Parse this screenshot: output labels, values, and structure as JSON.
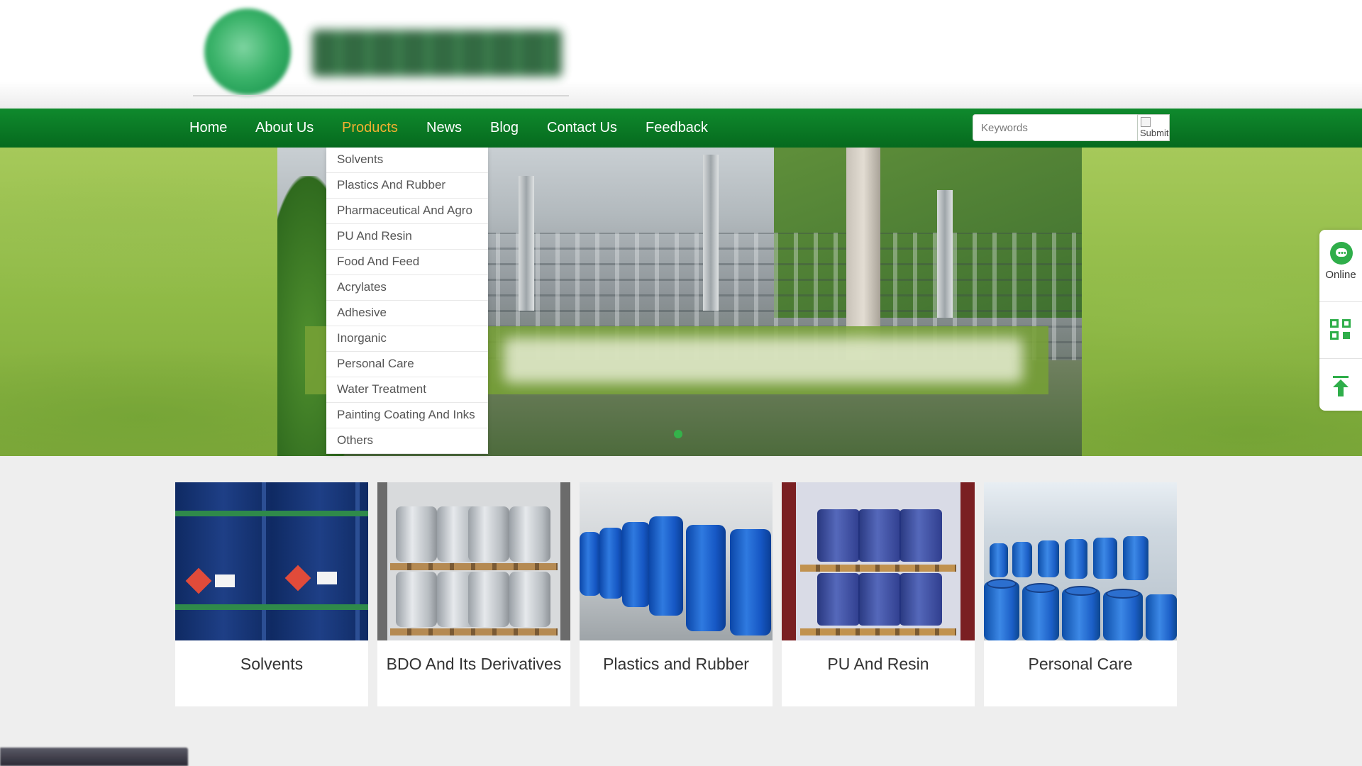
{
  "nav": {
    "items": [
      {
        "label": "Home",
        "active": false
      },
      {
        "label": "About Us",
        "active": false
      },
      {
        "label": "Products",
        "active": true
      },
      {
        "label": "News",
        "active": false
      },
      {
        "label": "Blog",
        "active": false
      },
      {
        "label": "Contact Us",
        "active": false
      },
      {
        "label": "Feedback",
        "active": false
      }
    ],
    "active_color": "#f2b030"
  },
  "search": {
    "placeholder": "Keywords",
    "submit_label": "Submit"
  },
  "dropdown": {
    "items": [
      "Solvents",
      "Plastics And Rubber",
      "Pharmaceutical And Agro",
      "PU And Resin",
      "Food And Feed",
      "Acrylates",
      "Adhesive",
      "Inorganic",
      "Personal Care",
      "Water Treatment",
      "Painting Coating And Inks",
      "Others"
    ]
  },
  "products": [
    {
      "label": "Solvents"
    },
    {
      "label": "BDO And Its Derivatives"
    },
    {
      "label": "Plastics and Rubber"
    },
    {
      "label": "PU And Resin"
    },
    {
      "label": "Personal Care"
    }
  ],
  "side": {
    "online_label": "Online",
    "icons": [
      "chat-icon",
      "qr-code-icon",
      "back-to-top-icon"
    ]
  },
  "colors": {
    "nav_green": "#0f8a2d",
    "accent_green": "#2fae4a"
  }
}
